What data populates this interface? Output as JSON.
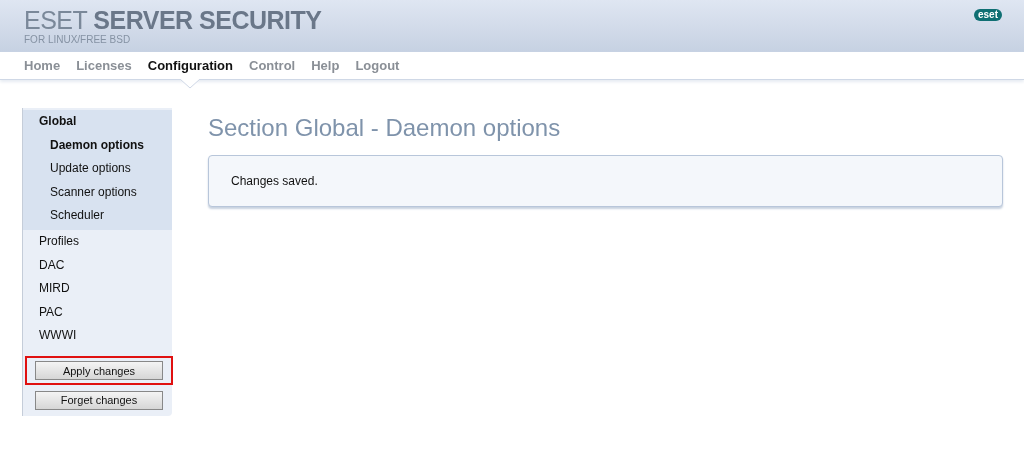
{
  "header": {
    "title": "ESET **SERVER SECURITY**",
    "subtitle": "FOR LINUX/FREE BSD",
    "logo": "eset"
  },
  "nav": [
    {
      "label": "Home",
      "selected": false
    },
    {
      "label": "Licenses",
      "selected": false
    },
    {
      "label": "Configuration",
      "selected": true
    },
    {
      "label": "Control",
      "selected": false
    },
    {
      "label": "Help",
      "selected": false
    },
    {
      "label": "Logout",
      "selected": false
    }
  ],
  "sidebar": {
    "items": [
      {
        "label": "Global",
        "expanded": true,
        "children": [
          {
            "label": "Daemon options",
            "selected": true
          },
          {
            "label": "Update options",
            "selected": false
          },
          {
            "label": "Scanner options",
            "selected": false
          },
          {
            "label": "Scheduler",
            "selected": false
          }
        ]
      },
      {
        "label": "Profiles",
        "expanded": false
      },
      {
        "label": "DAC",
        "expanded": false
      },
      {
        "label": "MIRD",
        "expanded": false
      },
      {
        "label": "PAC",
        "expanded": false
      },
      {
        "label": "WWWI",
        "expanded": false
      }
    ],
    "buttons": [
      {
        "label": "Apply changes",
        "highlighted": true
      },
      {
        "label": "Forget changes",
        "highlighted": false
      }
    ]
  },
  "main": {
    "title": "Section Global - Daemon options",
    "message": "Changes saved."
  }
}
